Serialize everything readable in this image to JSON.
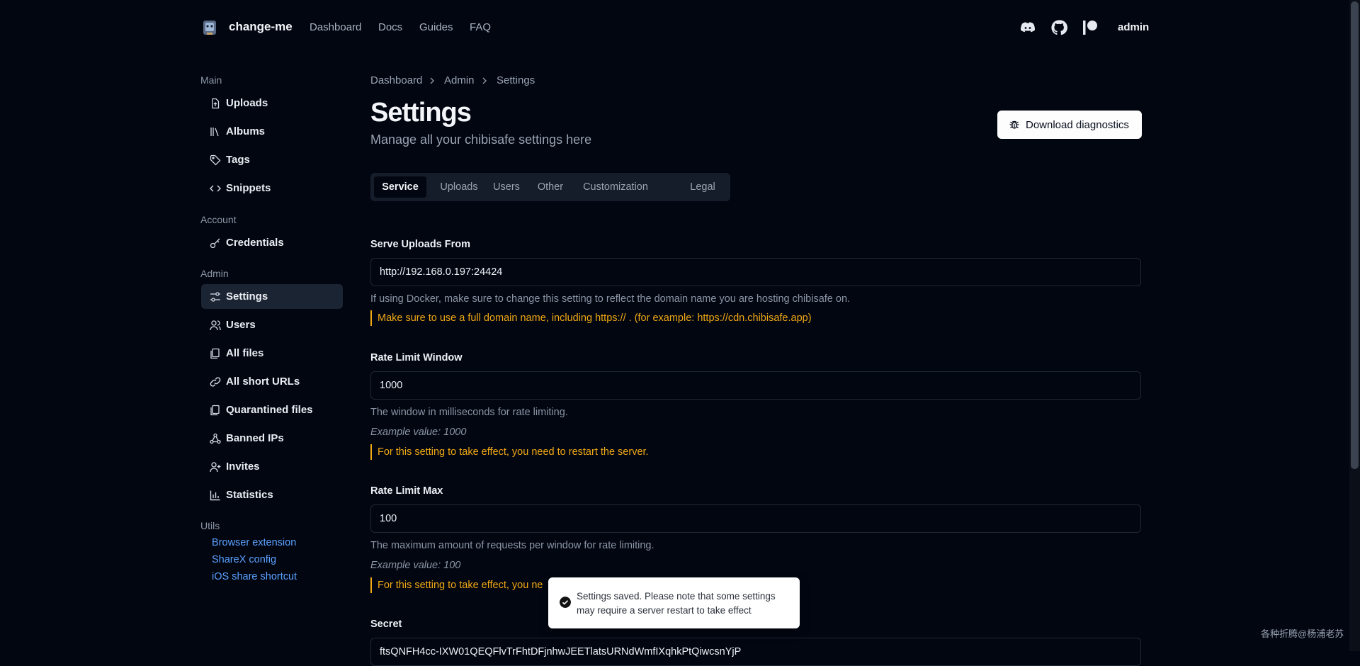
{
  "topbar": {
    "brand": "change-me",
    "nav": [
      "Dashboard",
      "Docs",
      "Guides",
      "FAQ"
    ],
    "icons": [
      "discord-icon",
      "github-icon",
      "patreon-icon"
    ],
    "user": "admin"
  },
  "sidebar": {
    "main_heading": "Main",
    "main_items": [
      "Uploads",
      "Albums",
      "Tags",
      "Snippets"
    ],
    "account_heading": "Account",
    "account_items": [
      "Credentials"
    ],
    "admin_heading": "Admin",
    "admin_items": [
      "Settings",
      "Users",
      "All files",
      "All short URLs",
      "Quarantined files",
      "Banned IPs",
      "Invites",
      "Statistics"
    ],
    "utils_heading": "Utils",
    "utils_links": [
      "Browser extension",
      "ShareX config",
      "iOS share shortcut"
    ]
  },
  "breadcrumb": [
    "Dashboard",
    "Admin",
    "Settings"
  ],
  "page": {
    "title": "Settings",
    "subtitle": "Manage all your chibisafe settings here",
    "diagnostics_button": "Download diagnostics"
  },
  "tabs": [
    "Service",
    "Uploads",
    "Users",
    "Other",
    "Customization",
    "Legal"
  ],
  "fields": {
    "serve": {
      "label": "Serve Uploads From",
      "value": "http://192.168.0.197:24424",
      "help": "If using Docker, make sure to change this setting to reflect the domain name you are hosting chibisafe on.",
      "warning": "Make sure to use a full domain name, including https:// . (for example: https://cdn.chibisafe.app)"
    },
    "window": {
      "label": "Rate Limit Window",
      "value": "1000",
      "help": "The window in milliseconds for rate limiting.",
      "example": "Example value: 1000",
      "warning": "For this setting to take effect, you need to restart the server."
    },
    "max": {
      "label": "Rate Limit Max",
      "value": "100",
      "help": "The maximum amount of requests per window for rate limiting.",
      "example": "Example value: 100",
      "warning": "For this setting to take effect, you ne"
    },
    "secret": {
      "label": "Secret",
      "value": "ftsQNFH4cc-IXW01QEQFlvTrFhtDFjnhwJEETlatsURNdWmfIXqhkPtQiwcsnYjP"
    }
  },
  "toast": {
    "message": "Settings saved. Please note that some settings may require a server restart to take effect"
  },
  "watermark": "各种折腾@杨浦老苏",
  "colors": {
    "background": "#020611",
    "accent_link": "#5aa1ff",
    "warning": "#f0a814",
    "active_nav": "#1b2433"
  }
}
